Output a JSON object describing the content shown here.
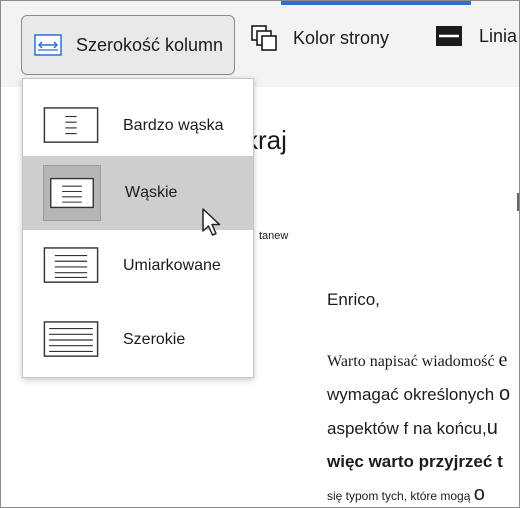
{
  "ribbon": {
    "column_width_label": "Szerokość kolumn",
    "page_color_label": "Kolor strony",
    "line_label": "Linia"
  },
  "menu": {
    "items": [
      {
        "label": "Bardzo wąska"
      },
      {
        "label": "Wąskie"
      },
      {
        "label": "Umiarkowane"
      },
      {
        "label": "Szerokie"
      }
    ],
    "selected": "Wąskie"
  },
  "document": {
    "title_fragment": "kraj",
    "small_fragment": "tanew",
    "greeting": "Enrico,",
    "lines": [
      {
        "text": "Warto napisać wiadomość ",
        "tail": "e"
      },
      {
        "text": "wymagać określonych ",
        "tail": "o"
      },
      {
        "text": "aspektów f na końcu,",
        "tail": "u"
      },
      {
        "text": "więc warto przyjrzeć  ",
        "tail": "t"
      },
      {
        "text": "się typom tych, które mogą ",
        "tail": "o"
      }
    ]
  },
  "colors": {
    "accent": "#2a6fd6",
    "ribbon_bg": "#f3f3f3",
    "selected_bg": "#cecece"
  }
}
